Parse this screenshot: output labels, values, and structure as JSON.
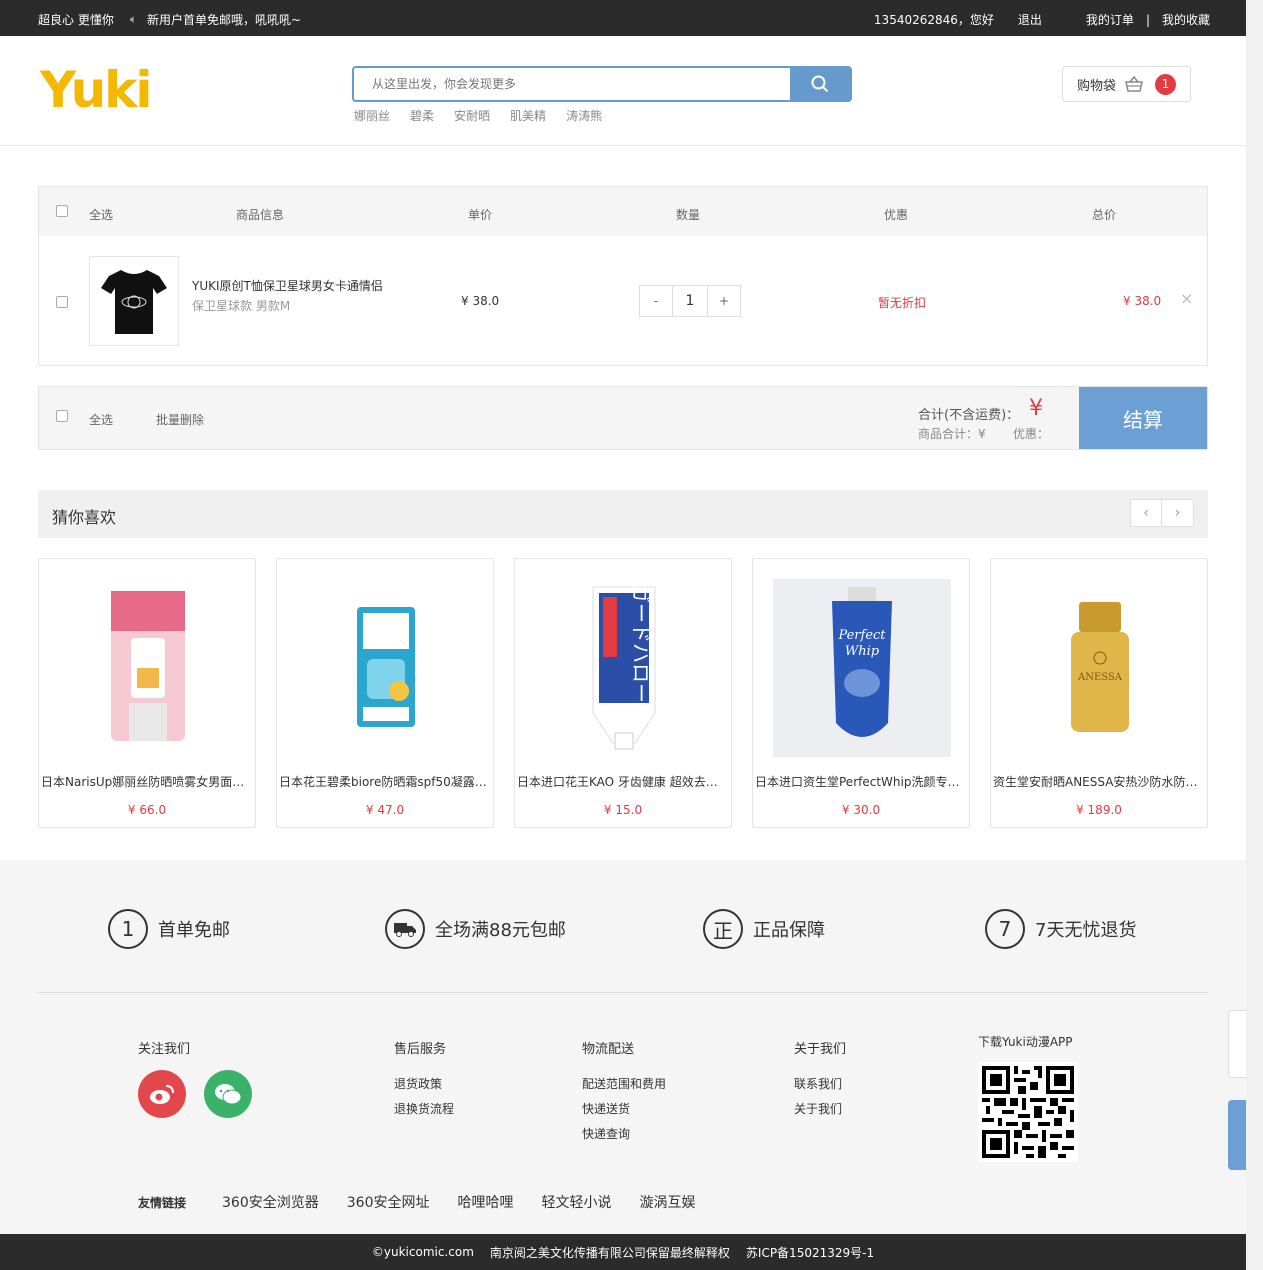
{
  "topbar": {
    "slogan": "超良心 更懂你",
    "notice": "新用户首单免邮哦，吼吼吼~",
    "user": "13540262846，您好",
    "logout": "退出",
    "orders": "我的订单",
    "sep": "|",
    "favorites": "我的收藏"
  },
  "header": {
    "logo": "Yuki",
    "search_placeholder": "从这里出发，你会发现更多",
    "hotwords": [
      "娜丽丝",
      "碧柔",
      "安耐晒",
      "肌美精",
      "涛涛熊"
    ],
    "bag_label": "购物袋",
    "bag_count": "1"
  },
  "cart": {
    "headers": {
      "select_all": "全选",
      "info": "商品信息",
      "unit_price": "单价",
      "quantity": "数量",
      "discount": "优惠",
      "total": "总价"
    },
    "items": [
      {
        "title": "YUKI原创T恤保卫星球男女卡通情侣",
        "spec": "保卫星球款 男款M",
        "price": "¥ 38.0",
        "qty_minus": "-",
        "qty": "1",
        "qty_plus": "+",
        "discount": "暂无折扣",
        "total": "¥ 38.0",
        "remove": "×"
      }
    ]
  },
  "summary": {
    "select_all": "全选",
    "batch_delete": "批量删除",
    "total_label": "合计(不含运费)：",
    "currency": "¥",
    "goods_total": "商品合计：¥",
    "discount_label": "优惠：",
    "checkout": "结算"
  },
  "guess": {
    "title": "猜你喜欢",
    "prev": "‹",
    "next": "›",
    "products": [
      {
        "name": "日本NarisUp娜丽丝防晒喷雾女男面部...",
        "price": "¥ 66.0",
        "color": "#f2a7b5"
      },
      {
        "name": "日本花王碧柔biore防晒霜spf50凝露男...",
        "price": "¥ 47.0",
        "color": "#3fb8d8"
      },
      {
        "name": "日本进口花王KAO 牙齿健康 超效去除...",
        "price": "¥ 15.0",
        "color": "#2b4fa6"
      },
      {
        "name": "日本进口资生堂PerfectWhip洗颜专科...",
        "price": "¥ 30.0",
        "color": "#2a58b8"
      },
      {
        "name": "资生堂安耐晒ANESSA安热沙防水防晒...",
        "price": "¥ 189.0",
        "color": "#d9a93a"
      }
    ]
  },
  "footer": {
    "guarantees": [
      {
        "icon": "1",
        "label": "首单免邮"
      },
      {
        "icon": "truck",
        "label": "全场满88元包邮"
      },
      {
        "icon": "正",
        "label": "正品保障"
      },
      {
        "icon": "7",
        "label": "7天无忧退货"
      }
    ],
    "follow": "关注我们",
    "columns": [
      {
        "title": "售后服务",
        "items": [
          "退货政策",
          "退换货流程"
        ]
      },
      {
        "title": "物流配送",
        "items": [
          "配送范围和费用",
          "快递送货",
          "快递查询"
        ]
      },
      {
        "title": "关于我们",
        "items": [
          "联系我们",
          "关于我们"
        ]
      }
    ],
    "app_title": "下载Yuki动漫APP",
    "friend_links_label": "友情链接",
    "friend_links": [
      "360安全浏览器",
      "360安全网址",
      "哈哩哈哩",
      "轻文轻小说",
      "漩涡互娱"
    ],
    "copyright": "©yukicomic.com",
    "company": "南京阅之美文化传播有限公司保留最终解释权",
    "icp": "苏ICP备15021329号-1"
  }
}
